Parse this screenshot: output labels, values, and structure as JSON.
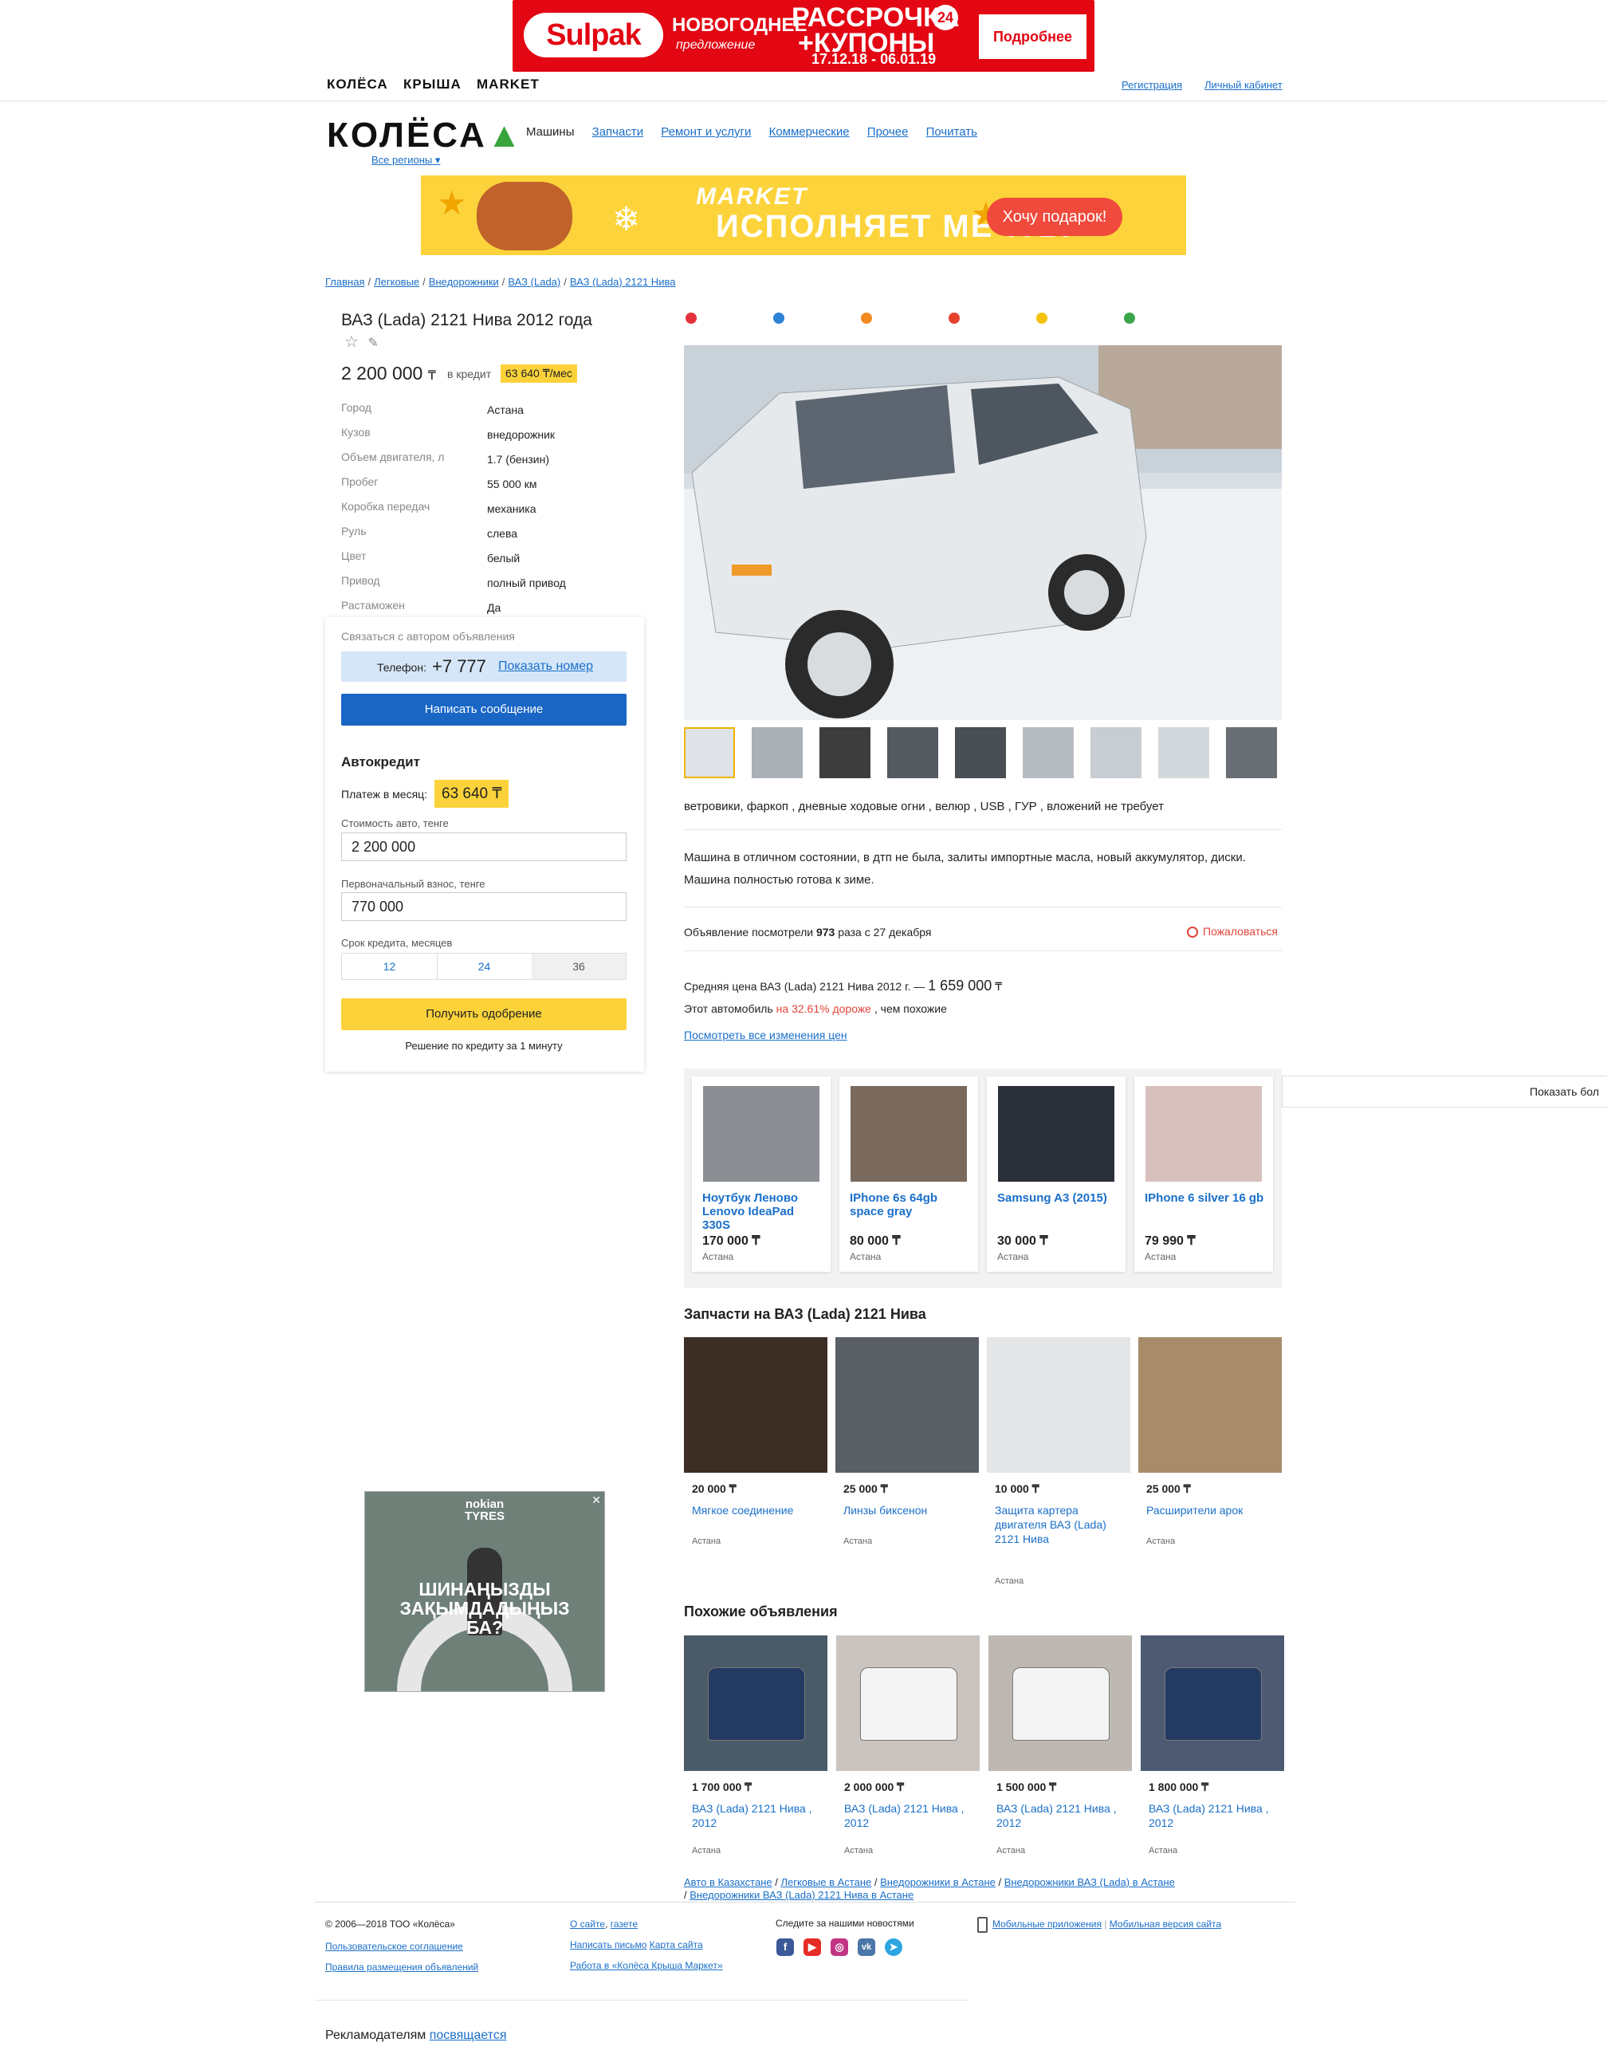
{
  "top_ad": {
    "brand": "Sulpak",
    "line1": "НОВОГОДНЕЕ",
    "line1b": "предложение",
    "line2": "РАССРОЧКА",
    "badge": "24",
    "line3": "+КУПОНЫ",
    "dates": "17.12.18 - 06.01.19",
    "button": "Подробнее"
  },
  "top_nav": {
    "brands": [
      "КОЛЁСА",
      "КРЫША",
      "MARKET"
    ],
    "register": "Регистрация",
    "cabinet": "Личный кабинет"
  },
  "header": {
    "logo": "КОЛЁСА",
    "region": "Все регионы",
    "nav": [
      "Машины",
      "Запчасти",
      "Ремонт и услуги",
      "Коммерческие",
      "Прочее",
      "Почитать"
    ]
  },
  "market_banner": {
    "brand": "MARKET",
    "slogan": "ИСПОЛНЯЕТ МЕЧТЫ",
    "button": "Хочу подарок!"
  },
  "breadcrumbs": [
    "Главная",
    "Легковые",
    "Внедорожники",
    "ВАЗ (Lada)",
    "ВАЗ (Lada) 2121 Нива"
  ],
  "listing": {
    "title": "ВАЗ (Lada) 2121 Нива 2012 года",
    "price": "2 200 000",
    "currency": "₸",
    "credit_label": "в кредит",
    "credit_badge": "63 640 ₸/мес",
    "specs": [
      {
        "k": "Город",
        "v": "Астана"
      },
      {
        "k": "Кузов",
        "v": "внедорожник"
      },
      {
        "k": "Объем двигателя, л",
        "v": "1.7 (бензин)"
      },
      {
        "k": "Пробег",
        "v": "55 000 км"
      },
      {
        "k": "Коробка передач",
        "v": "механика"
      },
      {
        "k": "Руль",
        "v": "слева"
      },
      {
        "k": "Цвет",
        "v": "белый"
      },
      {
        "k": "Привод",
        "v": "полный привод"
      },
      {
        "k": "Растаможен",
        "v": "Да"
      }
    ]
  },
  "contact": {
    "label": "Связаться с автором объявления",
    "phone_label": "Телефон:",
    "phone": "+7 777",
    "show_number": "Показать номер",
    "write": "Написать сообщение"
  },
  "autocredit": {
    "title": "Автокредит",
    "monthly_label": "Платеж в месяц:",
    "monthly_value": "63 640 ₸",
    "cost_label": "Стоимость авто, тенге",
    "cost_value": "2 200 000",
    "down_label": "Первоначальный взнос, тенге",
    "down_value": "770 000",
    "term_label": "Срок кредита, месяцев",
    "terms": [
      "12",
      "24",
      "36"
    ],
    "selected_term": "36",
    "approve": "Получить одобрение",
    "note": "Решение по кредиту за 1 минуту"
  },
  "nokian_ad": {
    "brand": "nokian TYRES",
    "text": "ШИНАҢЫЗДЫ ЗАҚЫМДАДЫҢЫЗ БА?"
  },
  "share_colors": [
    "#e3323b",
    "#2c82d6",
    "#f28a22",
    "#e6412d",
    "#f4c20d",
    "#3aa54a"
  ],
  "description": {
    "features": "ветровики, фаркоп , дневные ходовые огни , велюр , USB , ГУР , вложений не требует",
    "text_line1": "Машина в отличном состоянии, в дтп не была, залиты импортные масла, новый аккумулятор, диски.",
    "text_line2": "Машина полностью готова к зиме.",
    "views_prefix": "Объявление посмотрели",
    "views_count": "973",
    "views_suffix": "раза с 27 декабря",
    "complain": "Пожаловаться"
  },
  "price_stats": {
    "avg_label": "Средняя цена ВАЗ (Lada) 2121 Нива 2012 г. —",
    "avg_value": "1 659 000",
    "currency": "₸",
    "vs_prefix": "Этот автомобиль",
    "vs_highlight": "на 32.61% дороже",
    "vs_suffix": ", чем похожие",
    "history": "Посмотреть все изменения цен"
  },
  "market_items": [
    {
      "name": "Ноутбук Леново Lenovo IdeaPad 330S",
      "price": "170 000 ₸",
      "city": "Астана"
    },
    {
      "name": "IPhone 6s 64gb space gray",
      "price": "80 000 ₸",
      "city": "Астана"
    },
    {
      "name": "Samsung A3 (2015)",
      "price": "30 000 ₸",
      "city": "Астана"
    },
    {
      "name": "IPhone 6 silver 16 gb",
      "price": "79 990 ₸",
      "city": "Астана"
    }
  ],
  "more_button": "Показать бол",
  "parts": {
    "title": "Запчасти на ВАЗ (Lada) 2121 Нива",
    "items": [
      {
        "price": "20 000 ₸",
        "name": "Мягкое соединение",
        "city": "Астана"
      },
      {
        "price": "25 000 ₸",
        "name": "Линзы биксенон",
        "city": "Астана"
      },
      {
        "price": "10 000 ₸",
        "name": "Защита картера двигателя ВАЗ (Lada) 2121 Нива",
        "city": "Астана"
      },
      {
        "price": "25 000 ₸",
        "name": "Расширители арок",
        "city": "Астана"
      }
    ]
  },
  "similar": {
    "title": "Похожие объявления",
    "items": [
      {
        "price": "1 700 000 ₸",
        "name": "ВАЗ (Lada) 2121 Нива , 2012",
        "city": "Астана"
      },
      {
        "price": "2 000 000 ₸",
        "name": "ВАЗ (Lada) 2121 Нива , 2012",
        "city": "Астана"
      },
      {
        "price": "1 500 000 ₸",
        "name": "ВАЗ (Lada) 2121 Нива , 2012",
        "city": "Астана"
      },
      {
        "price": "1 800 000 ₸",
        "name": "ВАЗ (Lada) 2121 Нива , 2012",
        "city": "Астана"
      }
    ]
  },
  "bottom_crumbs": [
    "Авто в Казахстане",
    "Легковые в Астане",
    "Внедорожники в Астане",
    "Внедорожники ВАЗ (Lada) в Астане",
    "Внедорожники ВАЗ (Lada) 2121 Нива в Астане"
  ],
  "footer": {
    "copyright": "© 2006—2018 ТОО «Колёса»",
    "agreement": "Пользовательское соглашение",
    "rules": "Правила размещения объявлений",
    "about": "О сайте",
    "newspaper": "газете",
    "write_letter": "Написать письмо",
    "sitemap": "Карта сайта",
    "jobs": "Работа в «Колёса Крыша Маркет»",
    "follow": "Следите за нашими новостями",
    "apps": "Мобильные приложения",
    "mobile": "Мобильная версия сайта",
    "advertisers": "Рекламодателям",
    "dedicated": "посвящается"
  }
}
